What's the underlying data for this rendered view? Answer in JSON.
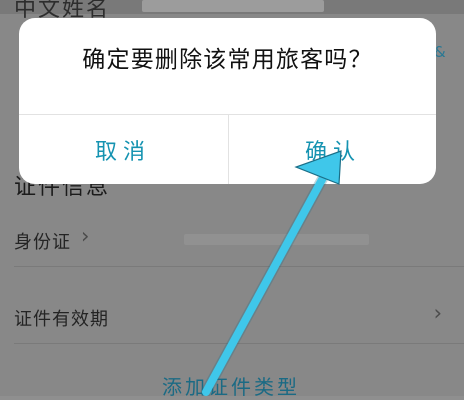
{
  "background": {
    "name_label": "中文姓名",
    "section_title": "证件信息",
    "id_label": "身份证",
    "validity_label": "证件有效期",
    "add_link": "添加证件类型",
    "side_mark": "&",
    "chevron_glyph": "›"
  },
  "dialog": {
    "message": "确定要删除该常用旅客吗？",
    "cancel_label": "取消",
    "confirm_label": "确认"
  },
  "colors": {
    "accent": "#1593B1",
    "arrow": "#3FC7EA",
    "dialog_background": "#FFFFFF",
    "screen_background": "#8E8E8E"
  }
}
